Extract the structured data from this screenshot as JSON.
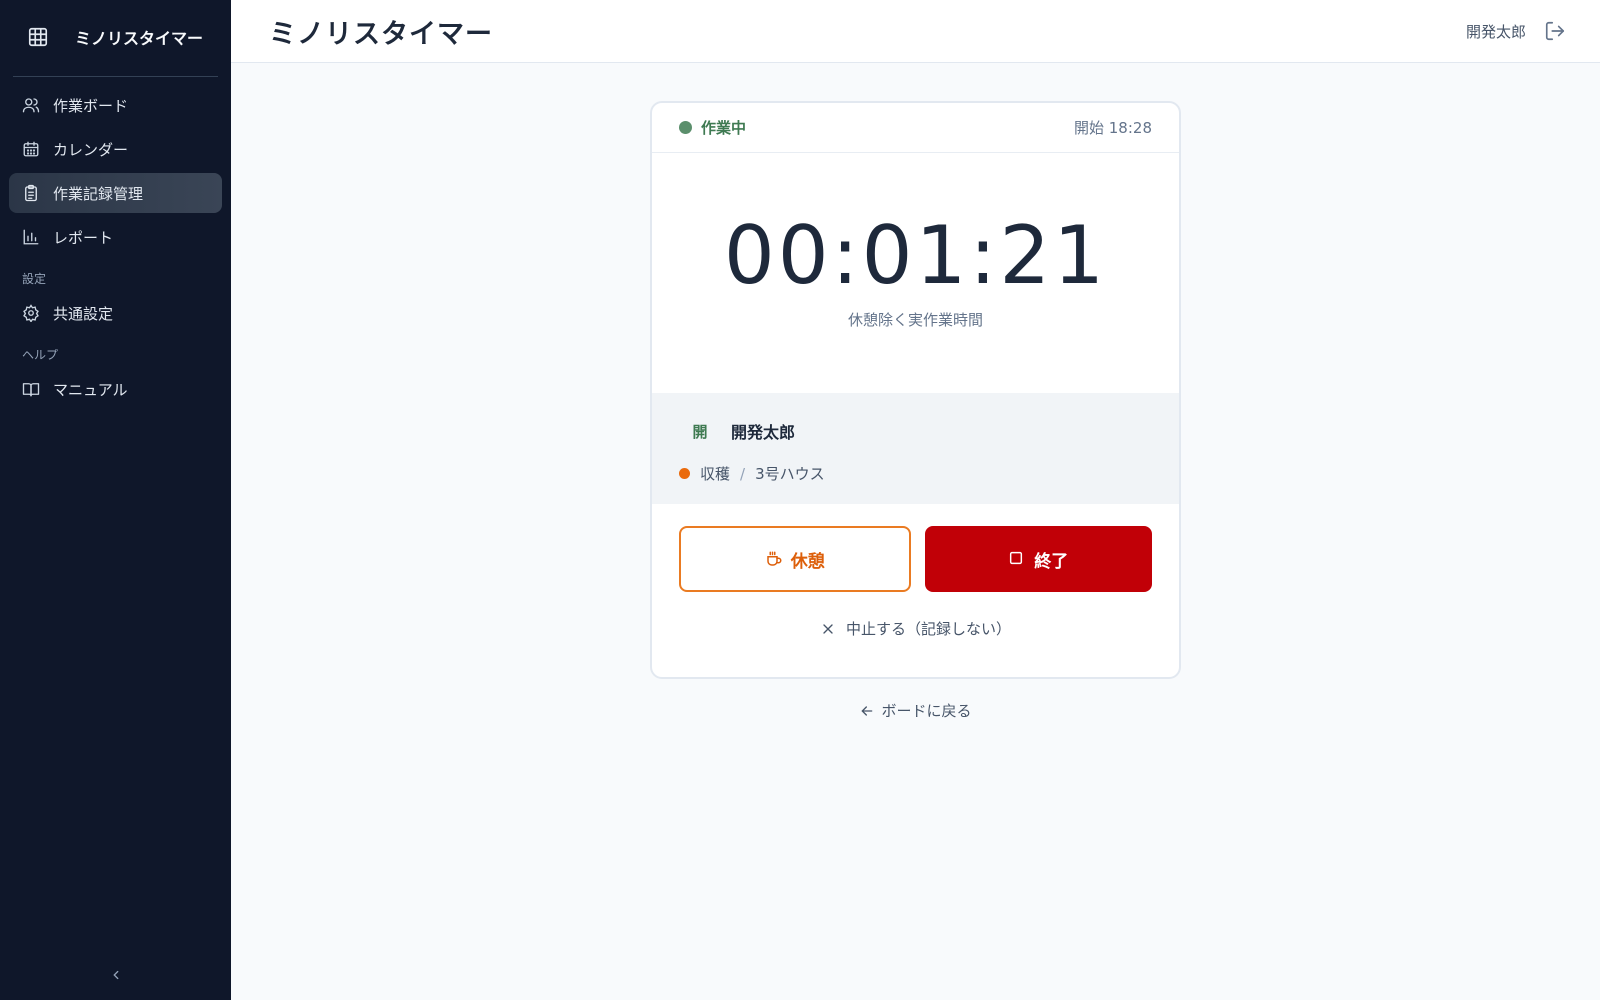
{
  "app": {
    "name": "ミノリスタイマー"
  },
  "header": {
    "title": "ミノリスタイマー",
    "user_name": "開発太郎"
  },
  "sidebar": {
    "items": [
      {
        "label": "作業ボード",
        "icon": "users-icon",
        "active": false
      },
      {
        "label": "カレンダー",
        "icon": "calendar-icon",
        "active": false
      },
      {
        "label": "作業記録管理",
        "icon": "clipboard-icon",
        "active": true
      },
      {
        "label": "レポート",
        "icon": "bar-chart-icon",
        "active": false
      }
    ],
    "settings_section": "設定",
    "settings_items": [
      {
        "label": "共通設定",
        "icon": "gear-icon"
      }
    ],
    "help_section": "ヘルプ",
    "help_items": [
      {
        "label": "マニュアル",
        "icon": "book-icon"
      }
    ]
  },
  "timer_card": {
    "status": "作業中",
    "start_time": "開始 18:28",
    "elapsed": "00:01:21",
    "elapsed_caption": "休憩除く実作業時間",
    "worker_initial": "開",
    "worker_name": "開発太郎",
    "task_category": "収穫",
    "task_separator": "/",
    "task_location": "3号ハウス",
    "break_button": "休憩",
    "end_button": "終了",
    "cancel_link": "中止する（記録しない）"
  },
  "back_link": "ボードに戻る",
  "colors": {
    "sidebar_bg": "#0f172a",
    "status_green": "#3f7a52",
    "break_orange": "#ea7b22",
    "end_red": "#c10007",
    "task_dot": "#ea6a0c"
  }
}
